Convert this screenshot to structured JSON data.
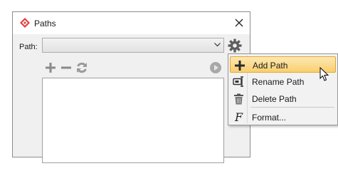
{
  "dialog": {
    "title": "Paths",
    "path_label": "Path:",
    "path_selected": ""
  },
  "icons": {
    "app": "diamond-logo-icon",
    "close": "close-icon",
    "dropdown": "chevron-down-icon",
    "settings": "gear-icon",
    "add": "plus-icon",
    "remove": "minus-icon",
    "refresh": "refresh-icon",
    "run": "play-icon"
  },
  "menu": {
    "items": [
      {
        "label": "Add Path",
        "icon": "plus-icon",
        "selected": true
      },
      {
        "label": "Rename Path",
        "icon": "rename-icon",
        "selected": false
      },
      {
        "label": "Delete Path",
        "icon": "trash-icon",
        "selected": false
      },
      {
        "label": "Format...",
        "icon": "function-icon",
        "selected": false
      }
    ]
  },
  "colors": {
    "accent": "#e04040",
    "menu_highlight": "#f9cf6f",
    "icon_gray": "#6b6b6b"
  }
}
